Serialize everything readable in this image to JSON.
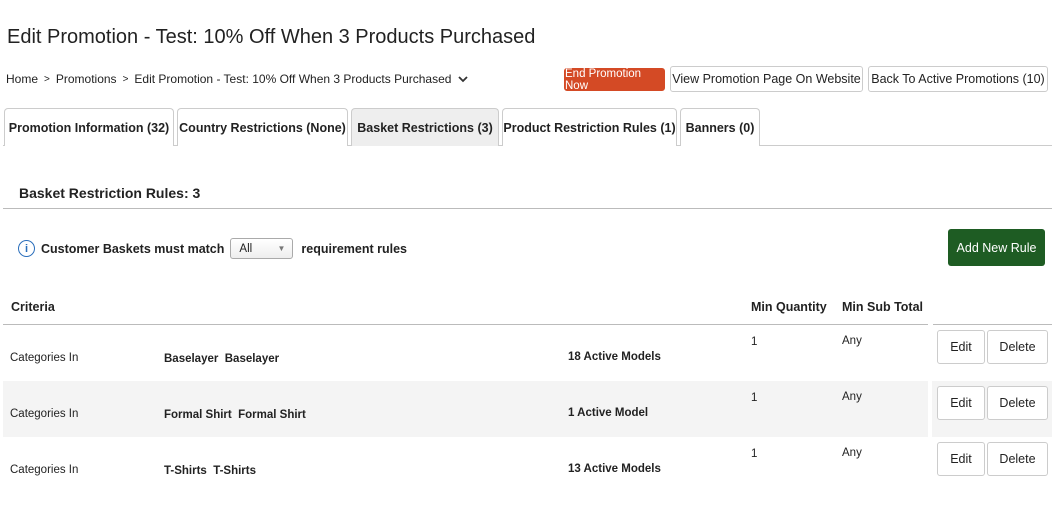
{
  "title": "Edit Promotion - Test: 10% Off When 3 Products Purchased",
  "breadcrumb": [
    "Home",
    "Promotions",
    "Edit Promotion - Test: 10% Off When 3 Products Purchased"
  ],
  "breadcrumb_sep": ">",
  "actions": {
    "end": "End Promotion Now",
    "view": "View Promotion Page On Website",
    "back": "Back To Active Promotions (10)"
  },
  "colors": {
    "end": "#d44a25",
    "add": "#1e5c23",
    "info": "#2a6ebb"
  },
  "tabs": [
    {
      "label": "Promotion Information (32)"
    },
    {
      "label": "Country Restrictions (None)"
    },
    {
      "label": "Basket Restrictions (3)",
      "active": true
    },
    {
      "label": "Product Restriction Rules (1)"
    },
    {
      "label": "Banners (0)"
    }
  ],
  "section_title": "Basket Restriction Rules: 3",
  "match": {
    "prefix": "Customer Baskets must match",
    "value": "All",
    "suffix": "requirement rules"
  },
  "add_rule": "Add New Rule",
  "columns": {
    "criteria": "Criteria",
    "min_qty": "Min Quantity",
    "min_sub": "Min Sub Total"
  },
  "rows": [
    {
      "criteria": "Categories In",
      "name": "Baselayer  Baselayer",
      "models": "18 Active Models",
      "min_qty": "1",
      "min_sub": "Any",
      "edit": "Edit",
      "delete": "Delete"
    },
    {
      "criteria": "Categories In",
      "name": "Formal Shirt  Formal Shirt",
      "models": "1 Active Model",
      "min_qty": "1",
      "min_sub": "Any",
      "edit": "Edit",
      "delete": "Delete"
    },
    {
      "criteria": "Categories In",
      "name": "T-Shirts  T-Shirts",
      "models": "13 Active Models",
      "min_qty": "1",
      "min_sub": "Any",
      "edit": "Edit",
      "delete": "Delete"
    }
  ]
}
